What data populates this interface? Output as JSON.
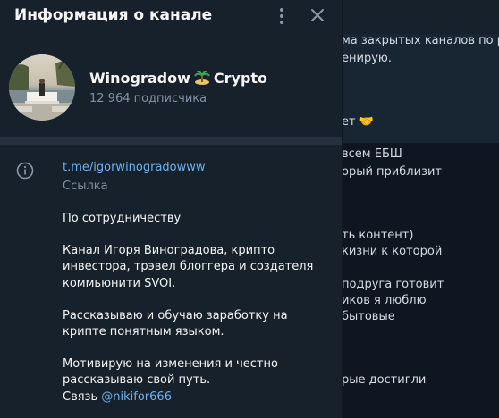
{
  "background_chat": {
    "lines": [
      "ма закрытых каналов по раз",
      "енирую",
      "ет",
      "всем ЕБШ",
      "орый приблизит",
      "ть контент)",
      "кизни к которой",
      "подруга готовит",
      "иков я люблю",
      "бытовые",
      "рые достигли"
    ]
  },
  "panel": {
    "title": "Информация о канале",
    "channel": {
      "name_part1": "Winogradow",
      "name_part2": "Crypto",
      "subscribers": "12 964 подписчика"
    },
    "link": {
      "url": "t.me/igorwinogradowww",
      "caption": "Ссылка"
    },
    "description": {
      "p1": "По сотрудничеству",
      "p2": "Канал Игоря Виноградова, крипто инвестора, трэвел блоггера и создателя коммьюнити SVOI.",
      "p3": "Рассказываю и обучаю заработку на крипте понятным языком.",
      "p4": "Мотивирую на изменения и честно рассказываю свой путь.",
      "contact_prefix": "Связь",
      "contact_handle": "@nikifor666"
    }
  },
  "colors": {
    "panel_bg": "#17212b",
    "accent_link": "#6ab2f2",
    "muted": "#7f91a4"
  }
}
